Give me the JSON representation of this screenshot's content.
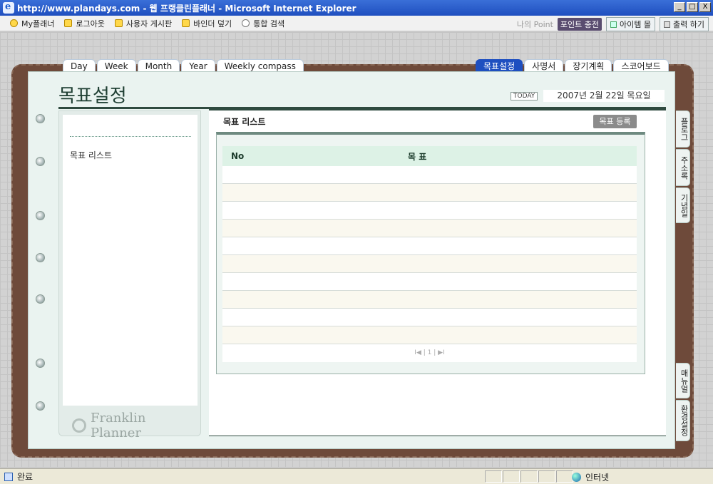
{
  "window": {
    "title": "http://www.plandays.com - 웹 프랭클린플래너 - Microsoft Internet Explorer",
    "buttons": [
      "_",
      "□",
      "X"
    ]
  },
  "menubar": {
    "items": [
      {
        "label": "My플래너",
        "icon": "smile-icon"
      },
      {
        "label": "로그아웃",
        "icon": "note-icon"
      },
      {
        "label": "사용자 게시판",
        "icon": "note-icon"
      },
      {
        "label": "바인더 덮기",
        "icon": "note-icon"
      },
      {
        "label": "통합 검색",
        "icon": "search-icon"
      }
    ],
    "point_label": "나의 Point",
    "charge_label": "포인트 충전",
    "item_mall_label": "아이템 몰",
    "print_label": "출력 하기"
  },
  "tabs_left": [
    "Day",
    "Week",
    "Month",
    "Year",
    "Weekly compass"
  ],
  "tabs_right": [
    "목표설정",
    "사명서",
    "장기계획",
    "스코어보드"
  ],
  "active_tab": "목표설정",
  "side_tabs_top": [
    "플로그",
    "주소록",
    "기념일"
  ],
  "side_tabs_bottom": [
    "매뉴얼",
    "환경설정"
  ],
  "header": {
    "title": "목표설정",
    "today_badge": "TODAY",
    "date": "2007년 2월 22일 목요일"
  },
  "left_panel": {
    "nav_item": "목표 리스트",
    "logo_text": "Franklin Planner"
  },
  "content": {
    "section_title": "목표 리스트",
    "register_button": "목표 등록",
    "columns": [
      "No",
      "목  표"
    ],
    "row_count": 10,
    "pager": "I◀ | 1 | ▶I"
  },
  "statusbar": {
    "status": "완료",
    "zone": "인터넷"
  }
}
